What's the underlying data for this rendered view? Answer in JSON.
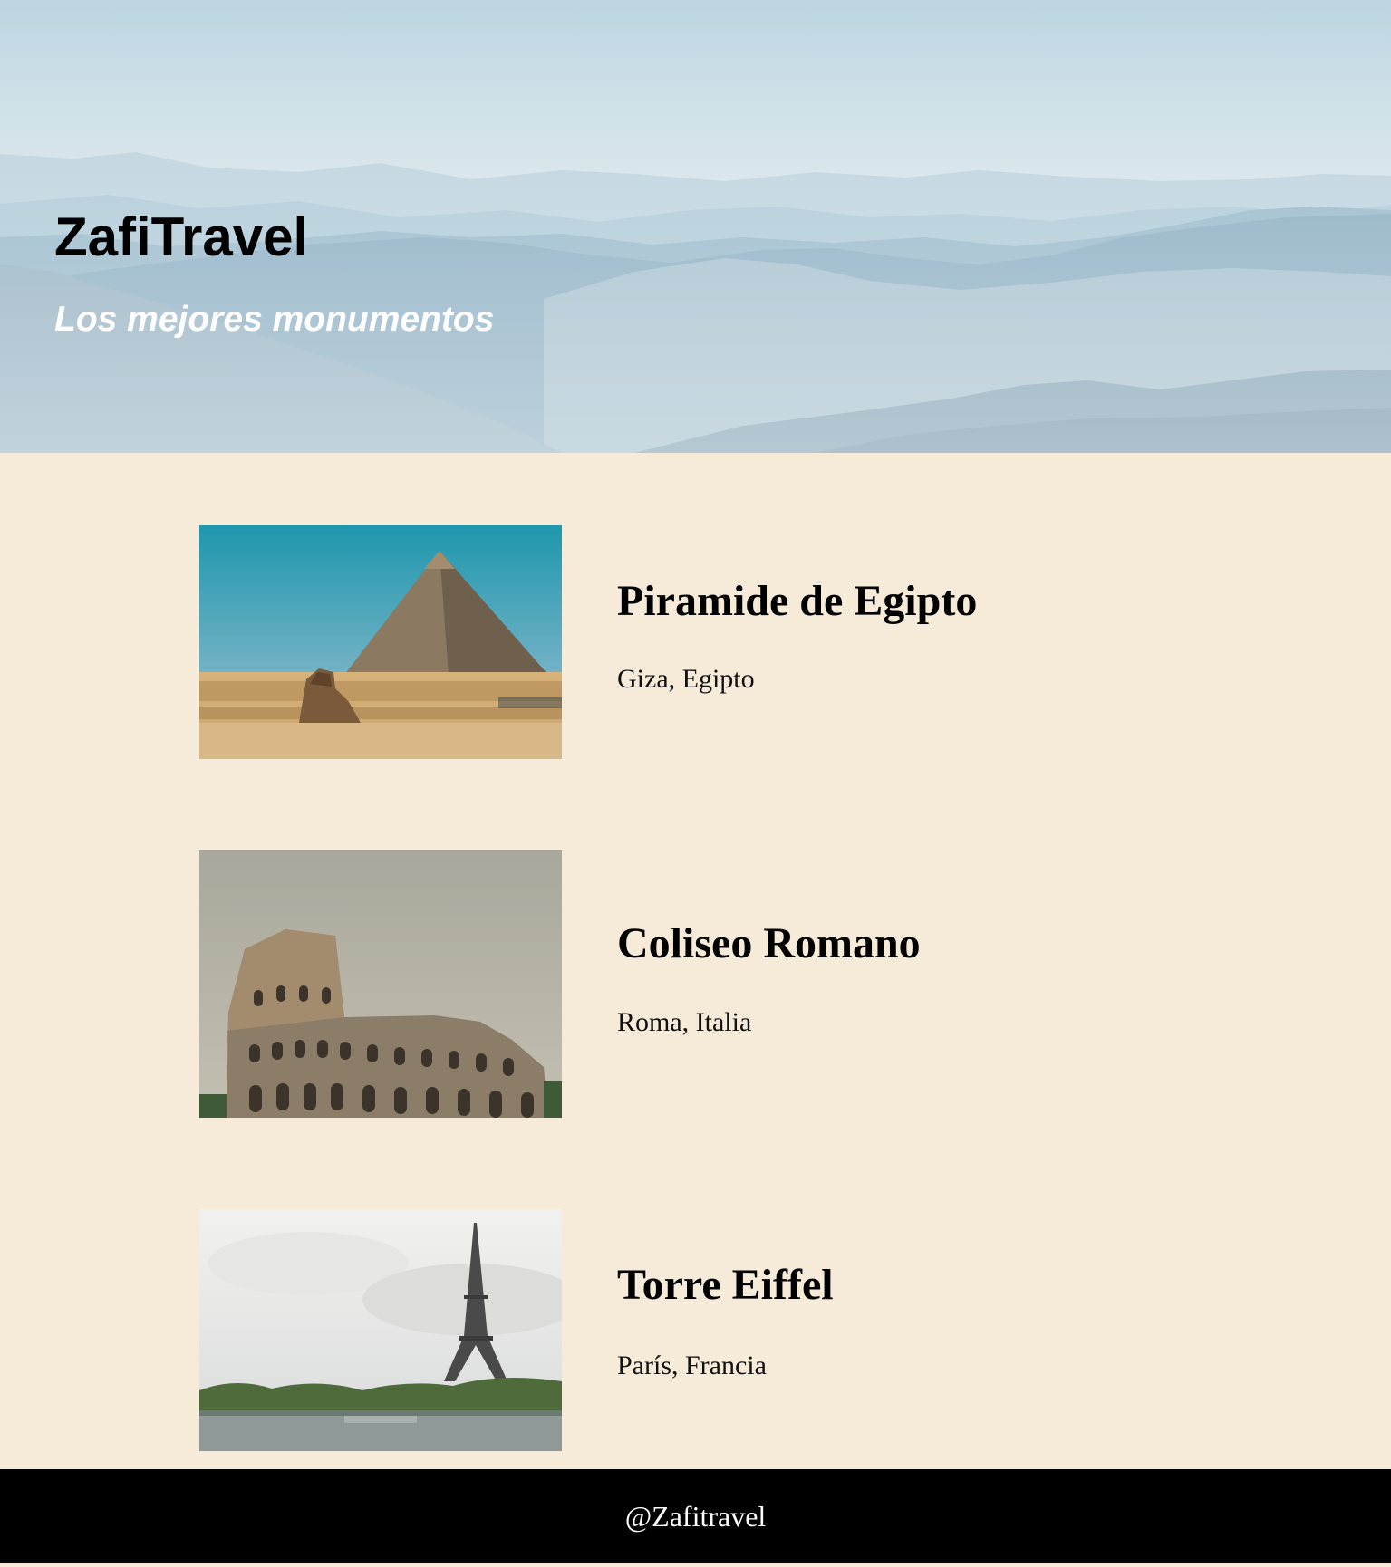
{
  "hero": {
    "title": "ZafiTravel",
    "subtitle": "Los mejores monumentos",
    "image": "misty-mountains-image"
  },
  "monuments": [
    {
      "name": "Piramide de Egipto",
      "location": "Giza, Egipto",
      "image": "pyramid-sphinx-image"
    },
    {
      "name": "Coliseo Romano",
      "location": "Roma, Italia",
      "image": "colosseum-image"
    },
    {
      "name": "Torre Eiffel",
      "location": "París, Francia",
      "image": "eiffel-tower-image"
    }
  ],
  "footer": {
    "handle": "@Zafitravel"
  },
  "colors": {
    "page_background": "#f6ead9",
    "footer_background": "#000000",
    "footer_text": "#ffffff",
    "title_text": "#000000",
    "subtitle_text": "#ffffff"
  }
}
